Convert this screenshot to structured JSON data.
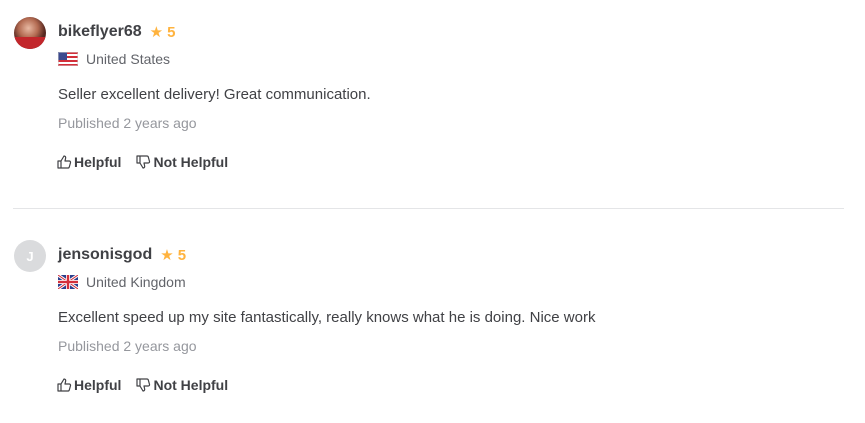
{
  "reviews": [
    {
      "username": "bikeflyer68",
      "rating": "5",
      "country": "United States",
      "flag_icon": "us-flag-icon",
      "avatar": "user-photo",
      "text": "Seller excellent delivery! Great communication.",
      "published": "Published 2 years ago",
      "helpful_label": "Helpful",
      "not_helpful_label": "Not Helpful"
    },
    {
      "username": "jensonisgod",
      "avatar_initial": "J",
      "rating": "5",
      "country": "United Kingdom",
      "flag_icon": "uk-flag-icon",
      "text": "Excellent speed up my site fantastically, really knows what he is doing. Nice work",
      "published": "Published 2 years ago",
      "helpful_label": "Helpful",
      "not_helpful_label": "Not Helpful"
    }
  ],
  "colors": {
    "star": "#ffb33e",
    "text": "#404145",
    "muted": "#95979d",
    "divider": "#e4e5e7"
  }
}
